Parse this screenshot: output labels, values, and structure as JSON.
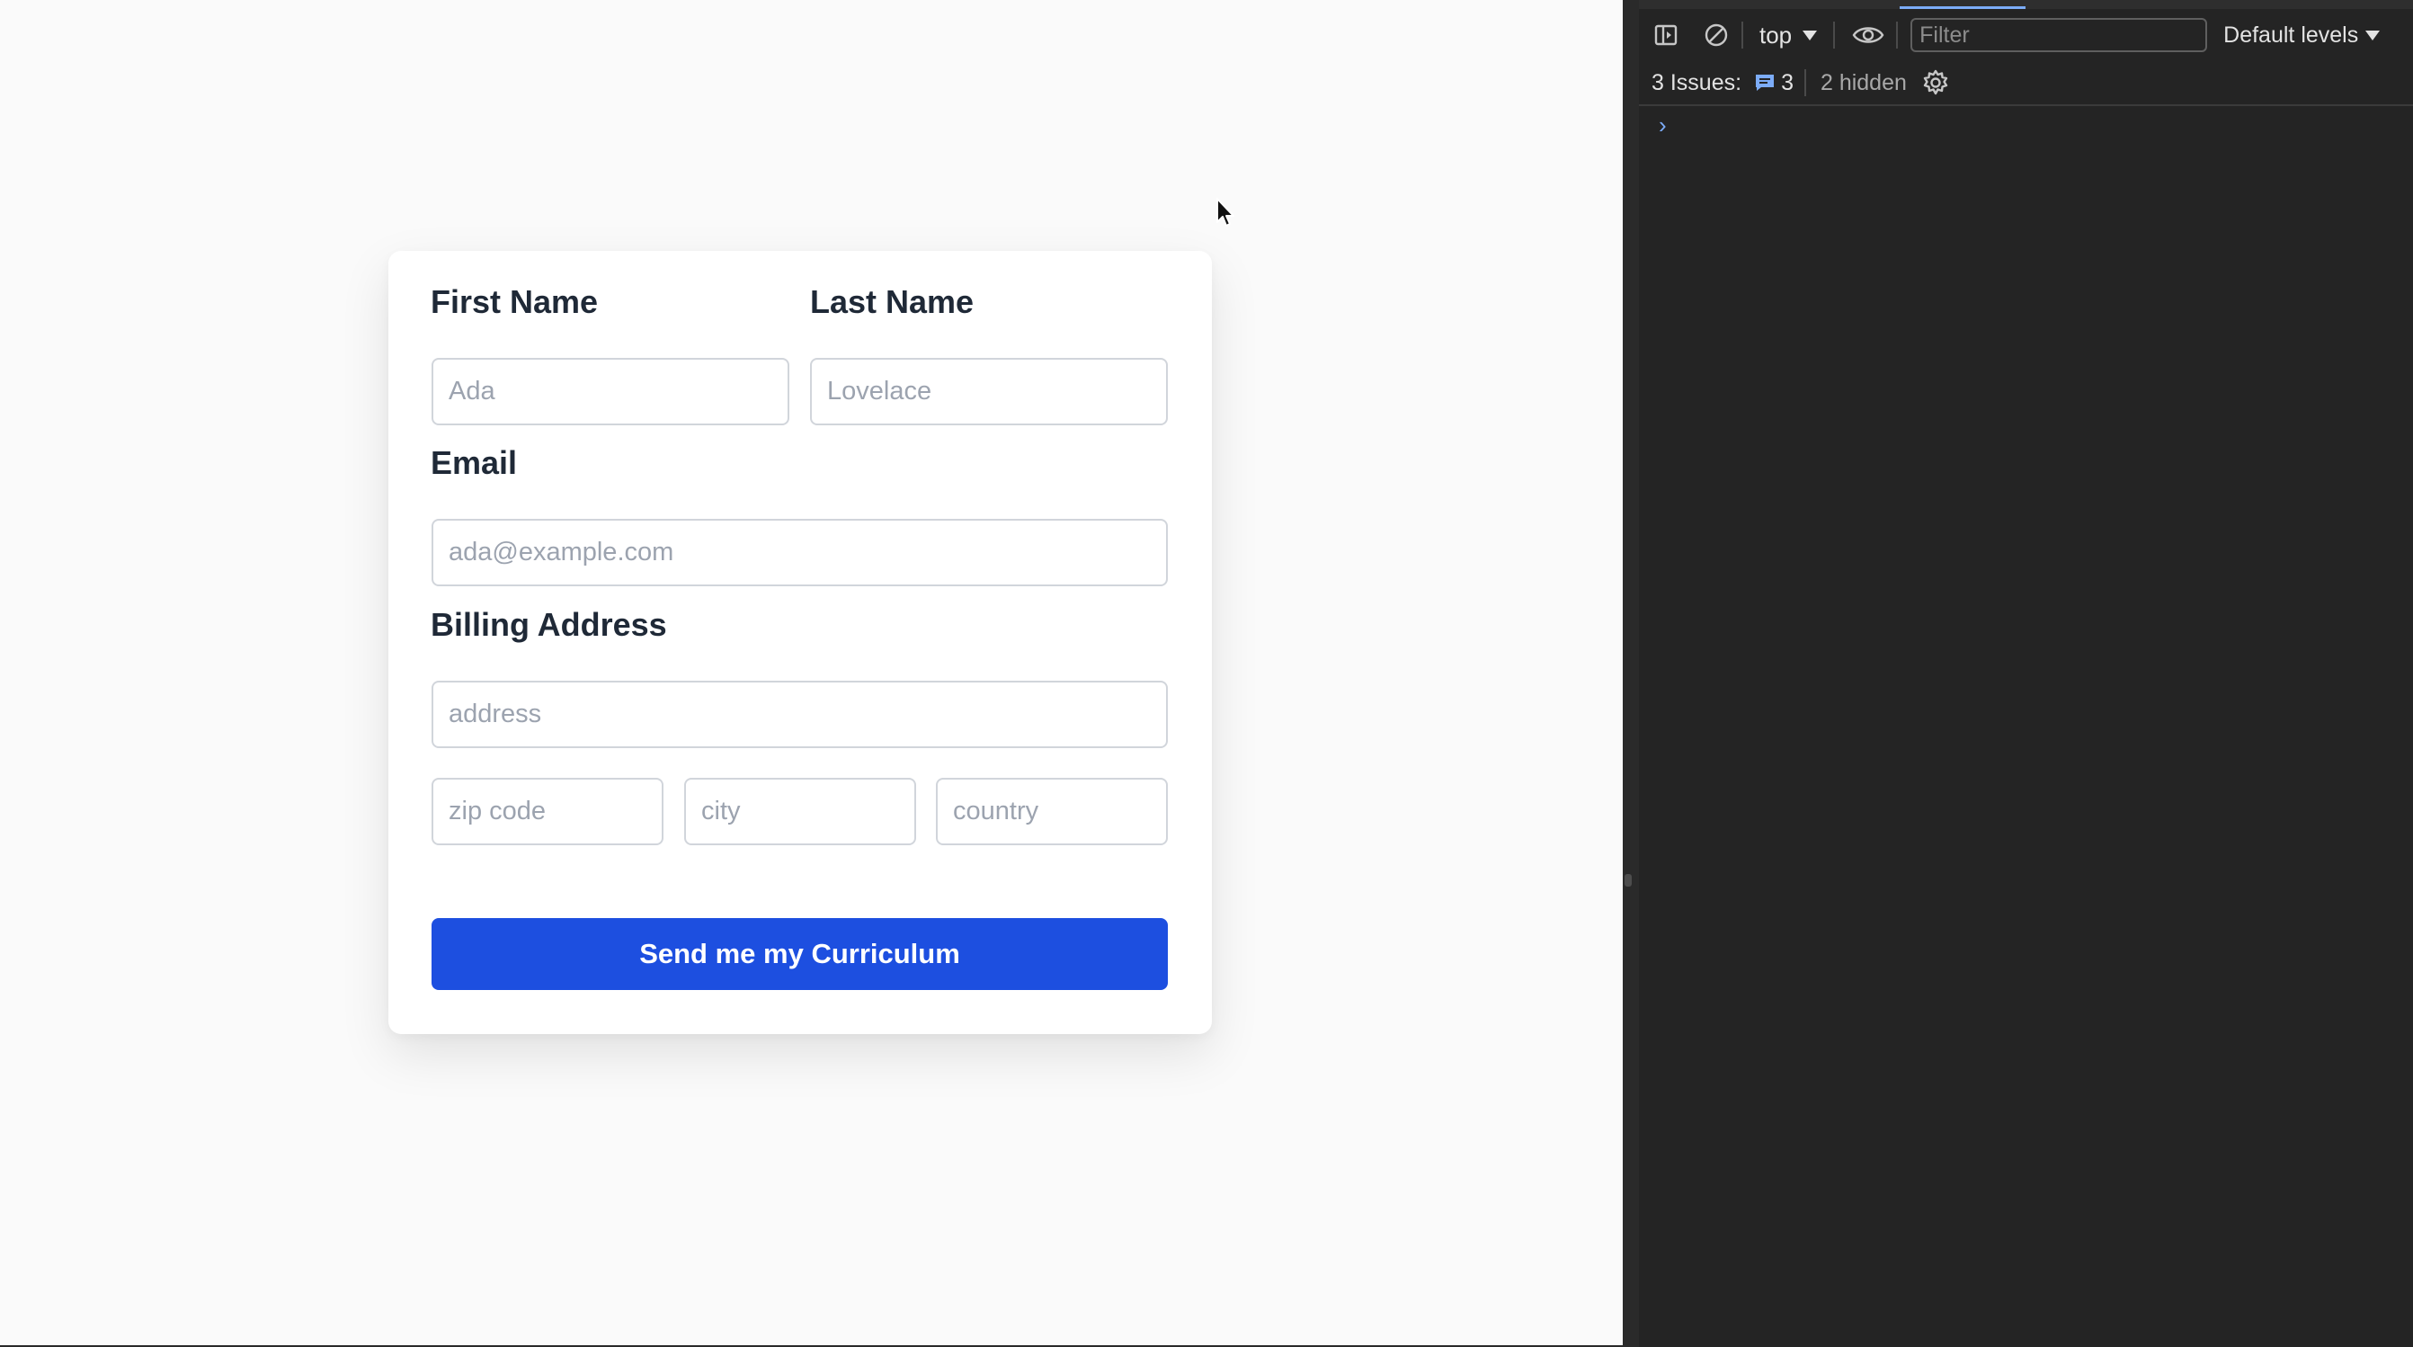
{
  "form": {
    "first_name": {
      "label": "First Name",
      "placeholder": "Ada"
    },
    "last_name": {
      "label": "Last Name",
      "placeholder": "Lovelace"
    },
    "email": {
      "label": "Email",
      "placeholder": "ada@example.com"
    },
    "billing": {
      "label": "Billing Address",
      "address_placeholder": "address",
      "zip_placeholder": "zip code",
      "city_placeholder": "city",
      "country_placeholder": "country"
    },
    "submit_label": "Send me my Curriculum"
  },
  "devtools": {
    "context": "top",
    "filter_placeholder": "Filter",
    "levels": "Default levels",
    "issues_label": "3 Issues:",
    "issues_count": "3",
    "hidden_label": "2 hidden",
    "prompt": "›"
  },
  "colors": {
    "button": "#1d4fe0",
    "devtools_bg": "#242424",
    "accent": "#7cacf8"
  }
}
